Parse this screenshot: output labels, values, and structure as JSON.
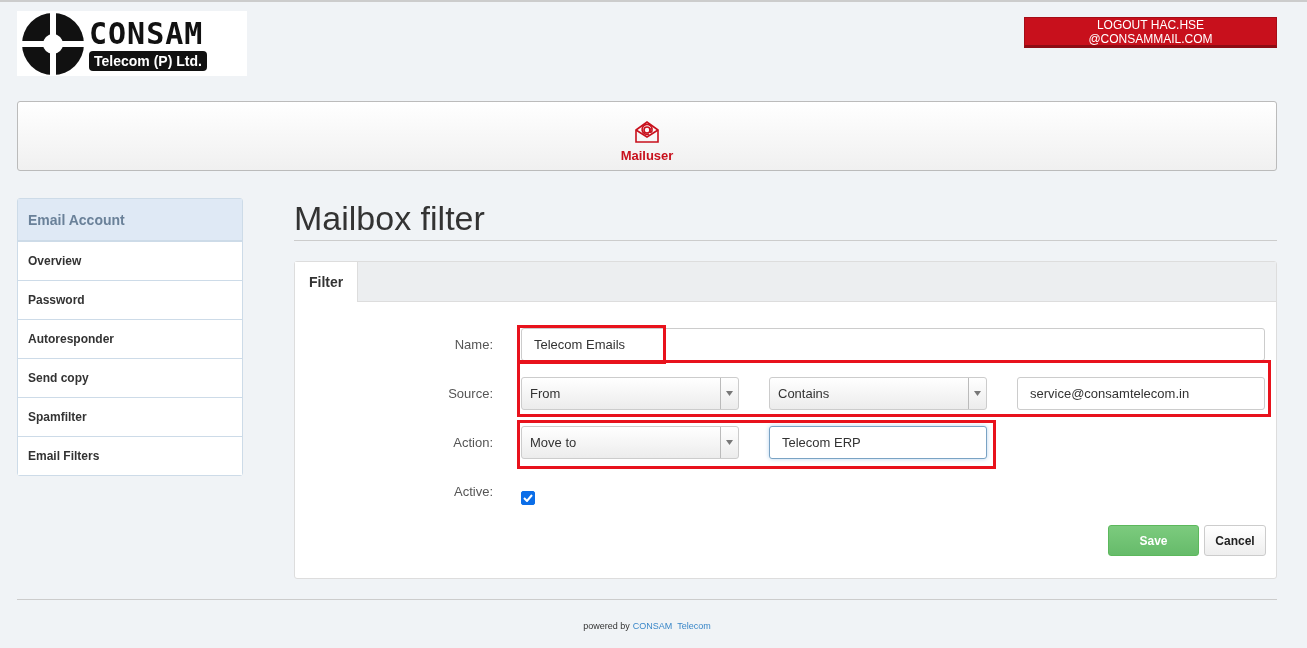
{
  "logo": {
    "name": "CONSAM",
    "tagline": "Telecom (P) Ltd."
  },
  "logout_button": "LOGOUT HAC.HSE @CONSAMMAIL.COM",
  "nav": {
    "label": "Mailuser",
    "selected": true
  },
  "sidebar": {
    "title": "Email Account",
    "items": [
      {
        "label": "Overview",
        "selected": false
      },
      {
        "label": "Password",
        "selected": false
      },
      {
        "label": "Autoresponder",
        "selected": false
      },
      {
        "label": "Send copy",
        "selected": false
      },
      {
        "label": "Spamfilter",
        "selected": false
      },
      {
        "label": "Email Filters",
        "selected": false
      }
    ]
  },
  "page_title": "Mailbox filter",
  "tabs": [
    {
      "label": "Filter",
      "selected": true
    }
  ],
  "form": {
    "rows": [
      {
        "label": "Name:",
        "highlighted": true,
        "controls": [
          {
            "kind": "input",
            "value": "Telecom Emails",
            "focused": false
          }
        ]
      },
      {
        "label": "Source:",
        "highlighted": true,
        "controls": [
          {
            "kind": "select",
            "value": "From"
          },
          {
            "kind": "select",
            "value": "Contains"
          },
          {
            "kind": "input",
            "value": "service@consamtelecom.in",
            "focused": false
          }
        ]
      },
      {
        "label": "Action:",
        "highlighted": true,
        "controls": [
          {
            "kind": "select",
            "value": "Move to"
          },
          {
            "kind": "input",
            "value": "Telecom ERP",
            "focused": true
          }
        ]
      },
      {
        "label": "Active:",
        "highlighted": false,
        "controls": [
          {
            "kind": "checkbox",
            "checked": true
          }
        ]
      }
    ],
    "buttons": [
      {
        "label": "Save",
        "kind": "primary"
      },
      {
        "label": "Cancel",
        "kind": "default"
      }
    ]
  },
  "footer": {
    "text": "powered by",
    "link": "CONSAM  Telecom"
  }
}
